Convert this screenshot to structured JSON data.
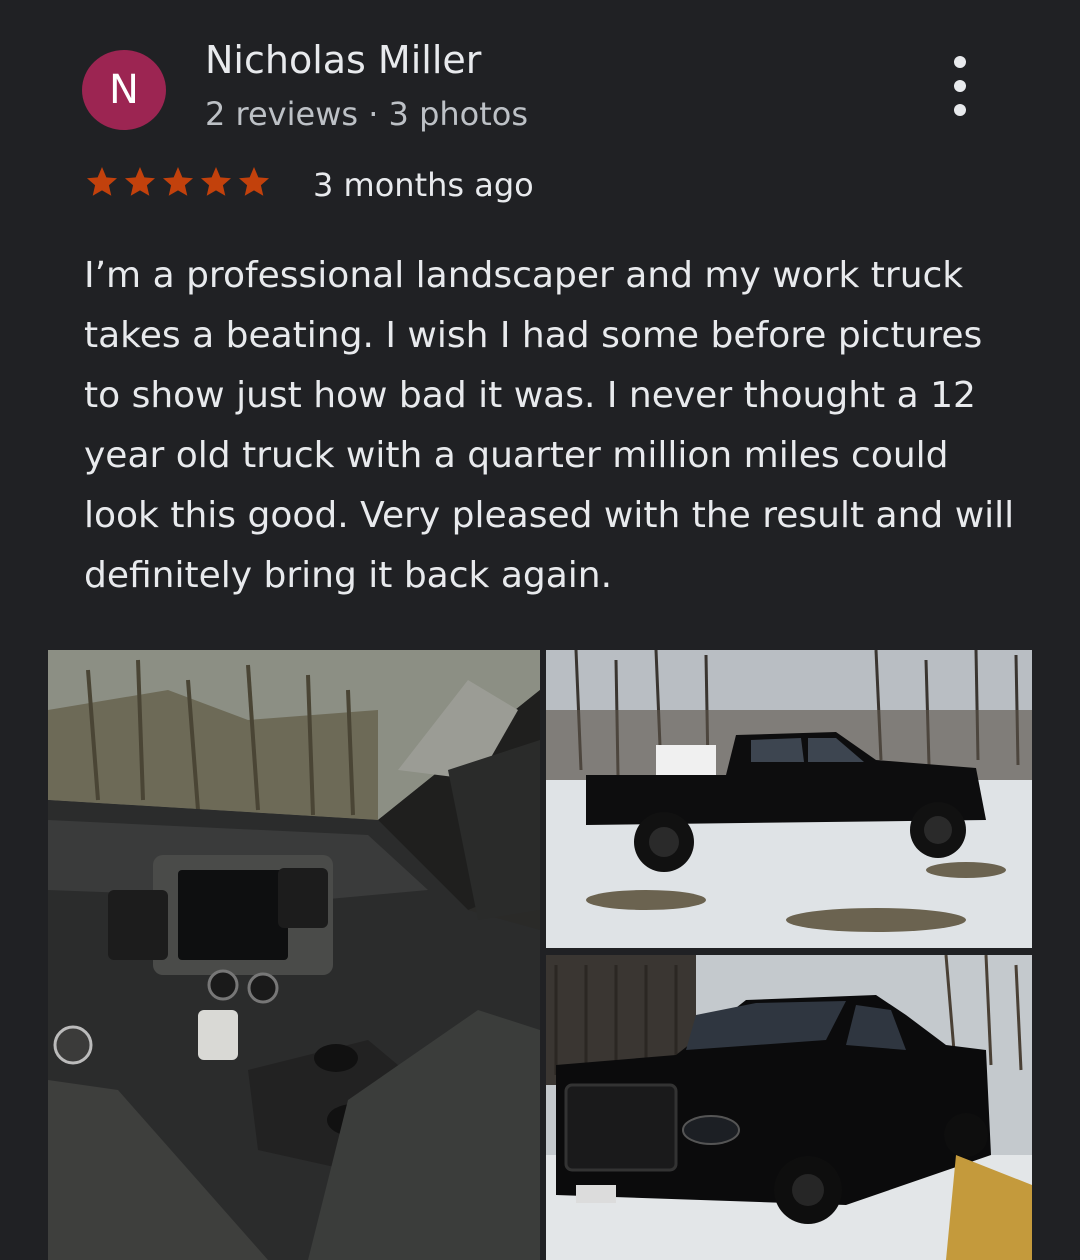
{
  "reviewer": {
    "avatar_letter": "N",
    "avatar_color": "#9c2552",
    "name": "Nicholas Miller",
    "meta": "2 reviews · 3 photos"
  },
  "more_menu": {
    "icon": "more-vert-icon"
  },
  "rating": {
    "stars": 5,
    "max": 5,
    "star_color": "#c2410c",
    "time": "3 months ago"
  },
  "review_text": "I’m a professional landscaper and my work truck takes a beating. I wish I had some before pictures to show just how bad it was. I never thought a 12 year old truck with a quarter million miles could look this good. Very pleased with the result and will definitely bring it back again.",
  "photos": [
    {
      "subject": "truck interior dashboard"
    },
    {
      "subject": "black pickup truck side view in snow"
    },
    {
      "subject": "black pickup truck front view in snow"
    }
  ]
}
